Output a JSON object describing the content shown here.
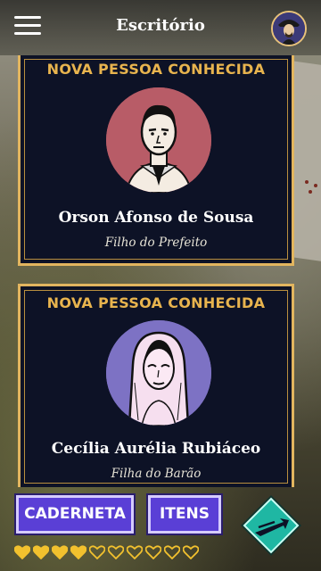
{
  "header": {
    "title": "Escritório",
    "menu_icon": "hamburger-menu-icon",
    "avatar_icon": "player-avatar"
  },
  "cards": [
    {
      "heading": "NOVA PESSOA CONHECIDA",
      "name": "Orson Afonso de Sousa",
      "role": "Filho do Prefeito",
      "portrait_bg": "#b85c67"
    },
    {
      "heading": "NOVA PESSOA CONHECIDA",
      "name": "Cecília Aurélia Rubiáceo",
      "role": "Filha do Barão",
      "portrait_bg": "#7d72c4"
    }
  ],
  "footer": {
    "caderneta_label": "CADERNETA",
    "itens_label": "ITENS",
    "next_icon": "arrow-right-icon",
    "hearts": {
      "filled": 4,
      "total": 10
    }
  },
  "colors": {
    "card_bg": "#0d1226",
    "gold": "#e2b55f",
    "heading": "#e8b44e",
    "button": "#5a3fd6",
    "next_button": "#1fb7a3",
    "heart": "#f2c12e"
  }
}
